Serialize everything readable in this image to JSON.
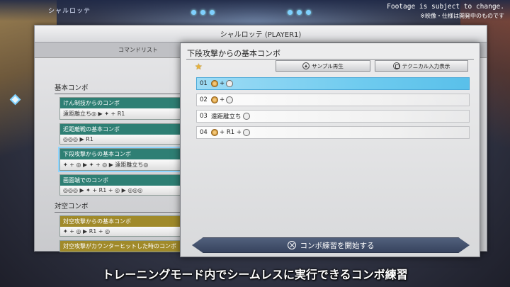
{
  "hud": {
    "player_name": "シャルロッテ"
  },
  "notice": {
    "line1": "Footage is subject to change.",
    "line2": "※映像・仕様は開発中のものです"
  },
  "back_window": {
    "title": "シャルロッテ (PLAYER1)",
    "tab": "コマンドリスト",
    "sections": [
      {
        "heading": "基本コンボ",
        "cards": [
          {
            "name": "けん制技からのコンボ",
            "cmd": "遠距離立ち◎ ▶ ✦ + R1"
          },
          {
            "name": "近距離戦の基本コンボ",
            "cmd": "◎◎◎ ▶ R1"
          },
          {
            "name": "下段攻撃からの基本コンボ",
            "cmd": "✦ + ◎ ▶ ✦ + ◎ ▶ 遠距離立ち◎"
          },
          {
            "name": "画面端でのコンボ",
            "cmd": "◎◎◎ ▶ ✦ + R1 + ◎ ▶ ◎◎◎"
          }
        ]
      },
      {
        "heading": "対空コンボ",
        "cards": [
          {
            "name": "対空攻撃からの基本コンボ",
            "cmd": "✦ + ◎ ▶ R1 + ◎"
          },
          {
            "name": "対空攻撃がカウンターヒットした時のコンボ",
            "cmd": ""
          }
        ]
      }
    ]
  },
  "front_panel": {
    "title": "下段攻撃からの基本コンボ",
    "sample_button": "サンプル再生",
    "technical_button": "テクニカル入力表示",
    "steps": [
      {
        "num": "01",
        "text": "+",
        "active": true
      },
      {
        "num": "02",
        "text": "+",
        "active": false
      },
      {
        "num": "03",
        "text": "遠距離立ち",
        "active": false
      },
      {
        "num": "04",
        "text": "+ R1 +",
        "active": false
      }
    ],
    "start_button": "コンボ練習を開始する"
  },
  "subtitle": "トレーニングモード内でシームレスに実行できるコンボ練習",
  "colors": {
    "accent_blue": "#6fcbef",
    "section_teal": "#2e7f74",
    "section_gold": "#a08a2a",
    "start_bar": "#41506c"
  }
}
